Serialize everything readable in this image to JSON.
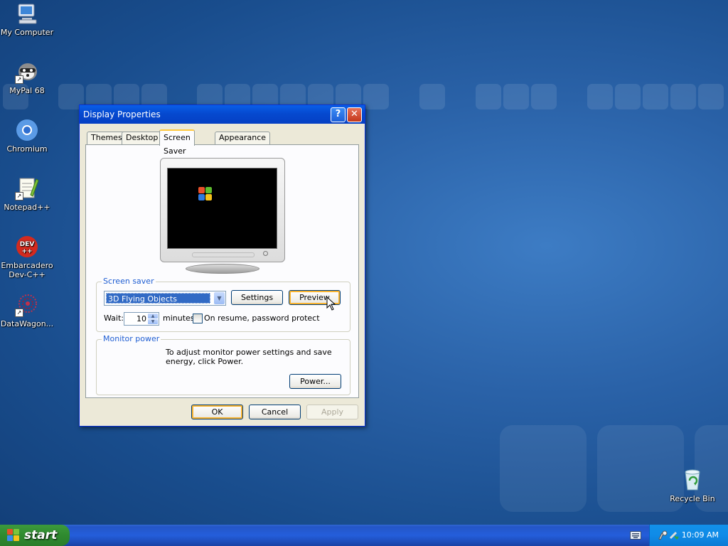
{
  "desktop": {
    "icons": [
      {
        "label": "My Computer"
      },
      {
        "label": "MyPal 68"
      },
      {
        "label": "Chromium"
      },
      {
        "label": "Notepad++"
      },
      {
        "label": "Embarcadero Dev-C++"
      },
      {
        "label": "DataWagon..."
      },
      {
        "label": "Recycle Bin"
      }
    ]
  },
  "window": {
    "title": "Display Properties",
    "help_glyph": "?",
    "close_glyph": "✕",
    "tabs": [
      {
        "label": "Themes"
      },
      {
        "label": "Desktop"
      },
      {
        "label": "Screen Saver",
        "active": true
      },
      {
        "label": "Appearance"
      }
    ],
    "screen_saver": {
      "group_title": "Screen saver",
      "selected": "3D Flying Objects",
      "settings_label": "Settings",
      "preview_label": "Preview",
      "wait_label": "Wait:",
      "wait_value": "10",
      "minutes_label": "minutes",
      "password_label": "On resume, password protect",
      "password_checked": false
    },
    "monitor_power": {
      "group_title": "Monitor power",
      "description": "To adjust monitor power settings and save energy, click Power.",
      "power_label": "Power..."
    },
    "buttons": {
      "ok": "OK",
      "cancel": "Cancel",
      "apply": "Apply"
    }
  },
  "taskbar": {
    "start_label": "start",
    "clock": "10:09 AM"
  },
  "colors": {
    "title_bar": "#0549cf",
    "accent_tab": "#ffc83c",
    "group_title": "#1f5ed2",
    "start_green": "#2f8a2f"
  }
}
